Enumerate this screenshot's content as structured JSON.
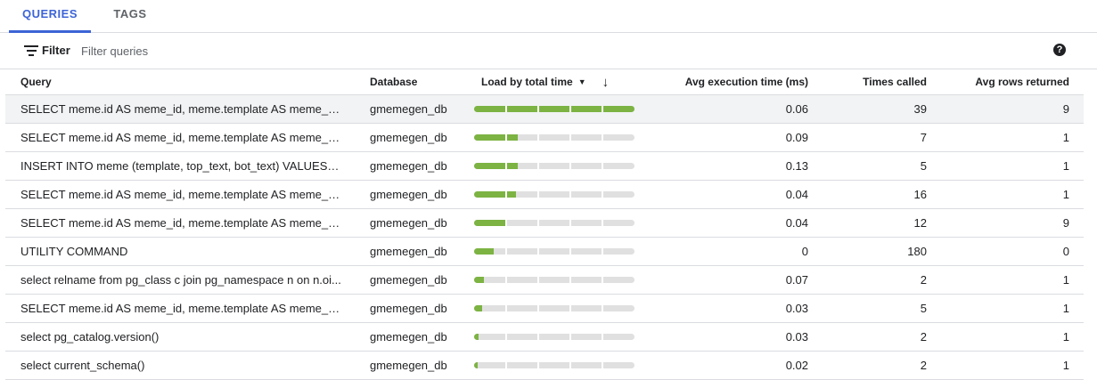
{
  "tabs": [
    {
      "label": "QUERIES",
      "active": true
    },
    {
      "label": "TAGS",
      "active": false
    }
  ],
  "filter": {
    "label": "Filter",
    "placeholder": "Filter queries"
  },
  "help_icon": "help-circle-icon",
  "columns": {
    "query": "Query",
    "database": "Database",
    "load": "Load by total time",
    "avg_exec": "Avg execution time (ms)",
    "times_called": "Times called",
    "avg_rows": "Avg rows returned"
  },
  "colors": {
    "accent": "#3c64d6",
    "bar_fill": "#7cb342",
    "bar_track": "#e0e0e0"
  },
  "rows": [
    {
      "query": "SELECT meme.id AS meme_id, meme.template AS meme_te...",
      "database": "gmemegen_db",
      "load": 1.0,
      "avg_exec": "0.06",
      "times_called": "39",
      "avg_rows": "9"
    },
    {
      "query": "SELECT meme.id AS meme_id, meme.template AS meme_te...",
      "database": "gmemegen_db",
      "load": 0.27,
      "avg_exec": "0.09",
      "times_called": "7",
      "avg_rows": "1"
    },
    {
      "query": "INSERT INTO meme (template, top_text, bot_text) VALUES ($...",
      "database": "gmemegen_db",
      "load": 0.27,
      "avg_exec": "0.13",
      "times_called": "5",
      "avg_rows": "1"
    },
    {
      "query": "SELECT meme.id AS meme_id, meme.template AS meme_te...",
      "database": "gmemegen_db",
      "load": 0.26,
      "avg_exec": "0.04",
      "times_called": "16",
      "avg_rows": "1"
    },
    {
      "query": "SELECT meme.id AS meme_id, meme.template AS meme_te...",
      "database": "gmemegen_db",
      "load": 0.2,
      "avg_exec": "0.04",
      "times_called": "12",
      "avg_rows": "9"
    },
    {
      "query": "UTILITY COMMAND",
      "database": "gmemegen_db",
      "load": 0.12,
      "avg_exec": "0",
      "times_called": "180",
      "avg_rows": "0"
    },
    {
      "query": "select relname from pg_class c join pg_namespace n on n.oi...",
      "database": "gmemegen_db",
      "load": 0.06,
      "avg_exec": "0.07",
      "times_called": "2",
      "avg_rows": "1"
    },
    {
      "query": "SELECT meme.id AS meme_id, meme.template AS meme_te...",
      "database": "gmemegen_db",
      "load": 0.05,
      "avg_exec": "0.03",
      "times_called": "5",
      "avg_rows": "1"
    },
    {
      "query": "select pg_catalog.version()",
      "database": "gmemegen_db",
      "load": 0.03,
      "avg_exec": "0.03",
      "times_called": "2",
      "avg_rows": "1"
    },
    {
      "query": "select current_schema()",
      "database": "gmemegen_db",
      "load": 0.02,
      "avg_exec": "0.02",
      "times_called": "2",
      "avg_rows": "1"
    }
  ]
}
